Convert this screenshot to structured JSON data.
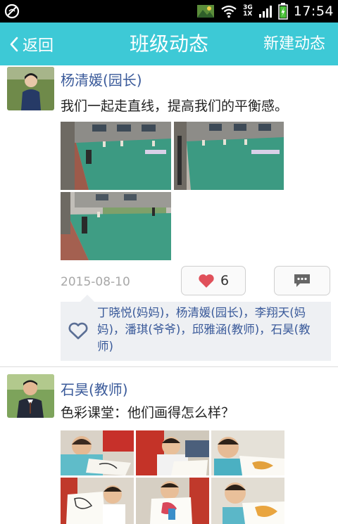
{
  "status_bar": {
    "time": "17:54",
    "network_top": "3G",
    "network_bottom": "1X",
    "icons": [
      "blocked-icon",
      "photo-notification-icon",
      "wifi-icon",
      "signal-icon",
      "battery-charging-icon"
    ]
  },
  "header": {
    "back_label": "返回",
    "title": "班级动态",
    "new_post_label": "新建动态",
    "color": "#3dc9d6"
  },
  "posts": [
    {
      "author": "杨清媛(园长)",
      "text": "我们一起走直线，提高我们的平衡感。",
      "photo_count": 3,
      "date": "2015-08-10",
      "like_count": "6",
      "likers": "丁晓悦(妈妈)，杨清媛(园长)，李翔天(妈妈)，潘琪(爷爷)，邱雅涵(教师)，石昊(教师)"
    },
    {
      "author": "石昊(教师)",
      "text": "色彩课堂：他们画得怎么样？",
      "photo_count": 6
    }
  ],
  "colors": {
    "author_name": "#3a5a9a",
    "like_heart": "#e0505a",
    "date": "#a8a8a8"
  }
}
